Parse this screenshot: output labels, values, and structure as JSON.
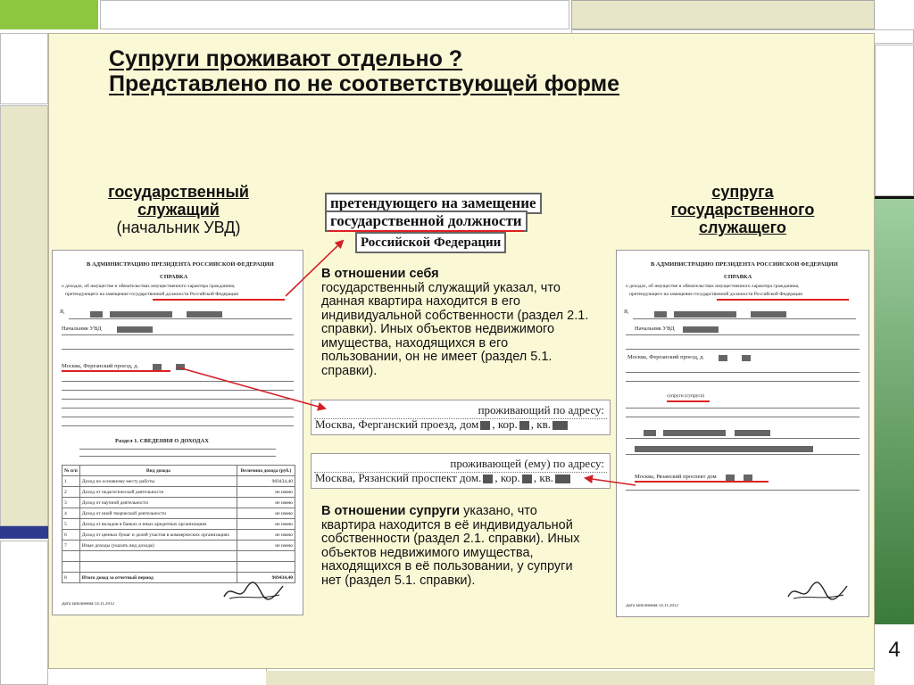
{
  "title": {
    "line1": "Супруги проживают отдельно ?",
    "line2": "Представлено по не соответствующей форме"
  },
  "left_heading": {
    "line1": "государственный",
    "line2": "служащий",
    "line3": "(начальник УВД)"
  },
  "right_heading": {
    "line1": "супруга",
    "line2": "государственного",
    "line3": "служащего"
  },
  "stamp": {
    "line1": "претендующего на замещение",
    "line2": "государственной должности",
    "line3": "Российской Федерации"
  },
  "address_box_1": {
    "label": "проживающий по адресу:",
    "value_prefix": "Москва, Ферганский проезд, дом",
    "corp": ", кор.",
    "apt": ", кв."
  },
  "address_box_2": {
    "label": "проживающей (ему) по адресу:",
    "value_prefix": "Москва, Рязанский проспект дом.",
    "corp": ", кор.",
    "apt": ", кв."
  },
  "note_self": {
    "bold": "В отношении себя",
    "text": "государственный служащий указал, что данная квартира находится в его индивидуальной собственности (раздел 2.1. справки). Иных объектов недвижимого имущества, находящихся в его пользовании, он не имеет (раздел 5.1. справки)."
  },
  "note_spouse": {
    "bold": "В отношении супруги",
    "text": " указано, что квартира находится в её индивидуальной собственности (раздел 2.1. справки). Иных объектов недвижимого имущества, находящихся в её пользовании, у супруги нет (раздел 5.1. справки)."
  },
  "doc_left": {
    "header": "В АДМИНИСТРАЦИЮ ПРЕЗИДЕНТА РОССИЙСКОЙ ФЕДЕРАЦИИ",
    "title": "СПРАВКА",
    "subtitle": "о доходах, об имуществе и обязательствах имущественного характера гражданина,",
    "subtitle2": "претендующего на замещение государственной должности Российской Федерации",
    "position": "Начальник УВД",
    "address": "Москва, Ферганский проезд, д.",
    "section": "Раздел 1.    СВЕДЕНИЯ О ДОХОДАХ",
    "table_head": [
      "№ п/п",
      "Вид дохода",
      "Величина дохода (руб.)"
    ],
    "rows": [
      [
        "1",
        "Доход по основному месту работы",
        "969434,40"
      ],
      [
        "2",
        "Доход от педагогической деятельности",
        "не имею"
      ],
      [
        "3",
        "Доход от научной деятельности",
        "не имею"
      ],
      [
        "4",
        "Доход от иной творческой деятельности",
        "не имею"
      ],
      [
        "5",
        "Доход от вкладов в банках и иных кредитных организациях",
        "не имею"
      ],
      [
        "6",
        "Доход от ценных бумаг и долей участия в коммерческих организациях",
        "не имею"
      ],
      [
        "7",
        "Иные доходы (указать вид дохода):",
        "не имею"
      ],
      [
        "8",
        "Итого доход за отчетный период",
        "969434,40"
      ]
    ],
    "date": "Дата заполнения 14.11.2012"
  },
  "doc_right": {
    "header": "В АДМИНИСТРАЦИЮ ПРЕЗИДЕНТА РОССИЙСКОЙ ФЕДЕРАЦИИ",
    "title": "СПРАВКА",
    "subtitle": "о доходах, об имуществе и обязательствах имущественного характера гражданина,",
    "subtitle2": "претендующего на замещение государственной должности Российской Федерации",
    "position": "Начальник УВД",
    "address": "Москва, Ферганский проезд, д.",
    "address2": "Москва, Рязанский проспект дом",
    "spouse_label": "супруги (супруга)",
    "date": "Дата заполнения 14.11.2012"
  },
  "page_number": "4",
  "colors": {
    "green": "#8dc63f",
    "blue": "#2e3a8c",
    "dark_green": "#3a7a3a",
    "red_arrow": "#d32027"
  }
}
